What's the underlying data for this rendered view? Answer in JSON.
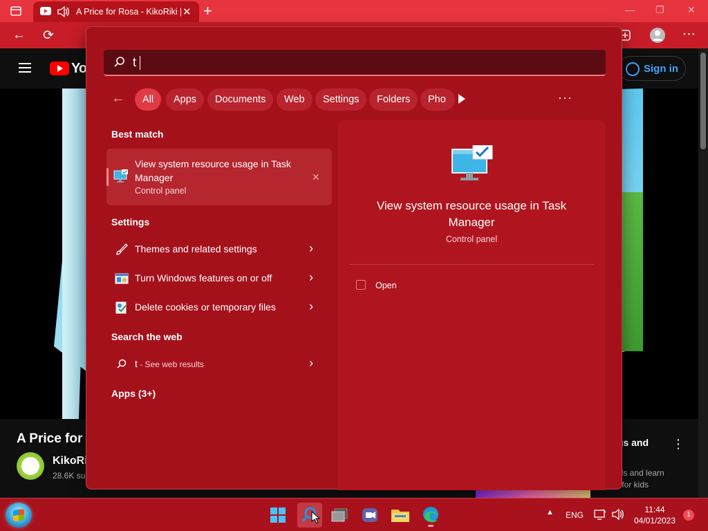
{
  "browser": {
    "tab_title": "A Price for Rosa - KikoRiki |",
    "tab_close": "✕",
    "new_tab": "+",
    "window_controls": {
      "minimize": "—",
      "restore": "❐",
      "close": "✕"
    },
    "nav": {
      "back": "←",
      "reload": "⟳",
      "menu": "⋯"
    }
  },
  "youtube": {
    "logo_text": "You",
    "signin_label": "Sign in",
    "video_title": "A Price for R",
    "channel_name": "KikoRil",
    "subscribers": "28.6K sul",
    "sidebar_title": "songs and ery...",
    "sidebar_desc": "this kids and learn colors for kids"
  },
  "search": {
    "query": "t",
    "filters": [
      "All",
      "Apps",
      "Documents",
      "Web",
      "Settings",
      "Folders",
      "Pho"
    ],
    "active_filter": "All",
    "more": "···",
    "best_match": {
      "heading": "Best match",
      "title": "View system resource usage in Task Manager",
      "subtitle": "Control panel"
    },
    "settings": {
      "heading": "Settings",
      "items": [
        {
          "label": "Themes and related settings",
          "icon": "brush-icon"
        },
        {
          "label": "Turn Windows features on or off",
          "icon": "windows-features-icon"
        },
        {
          "label": "Delete cookies or temporary files",
          "icon": "cookies-icon"
        }
      ]
    },
    "web": {
      "heading": "Search the web",
      "query": "t",
      "suffix": " - See web results"
    },
    "apps_heading": "Apps (3+)",
    "preview": {
      "title": "View system resource usage in Task Manager",
      "subtitle": "Control panel",
      "open_label": "Open"
    }
  },
  "taskbar": {
    "language": "ENG",
    "time": "11:44",
    "date": "04/01/2023",
    "notification_count": "1"
  },
  "colors": {
    "panel_bg": "#a5111b",
    "accent": "#e03b45",
    "taskbar": "#a9121c",
    "browser_chrome": "#e8343f"
  }
}
